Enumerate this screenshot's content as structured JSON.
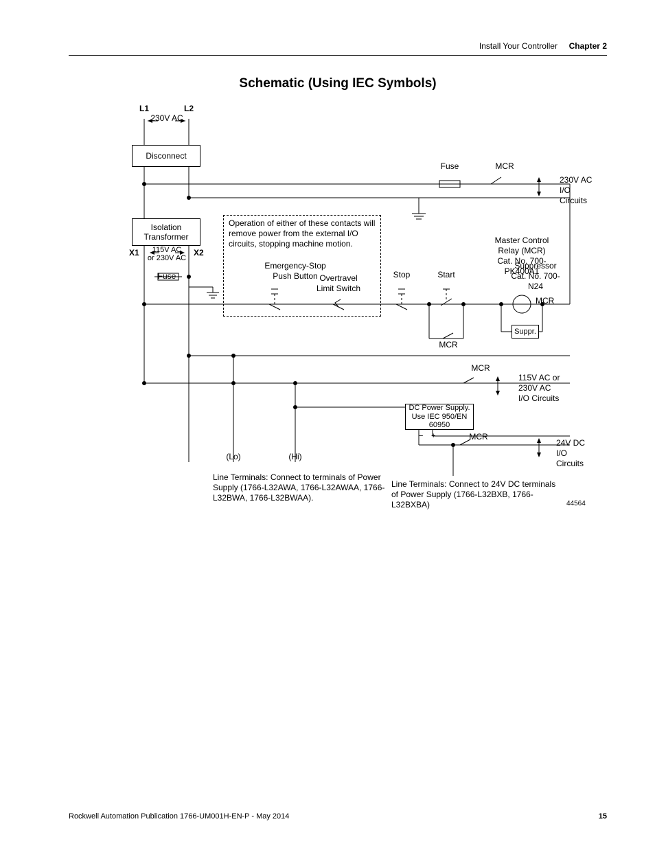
{
  "header": {
    "section_title": "Install Your Controller",
    "chapter_label": "Chapter 2"
  },
  "title": "Schematic (Using IEC Symbols)",
  "labels": {
    "L1": "L1",
    "L2": "L2",
    "v230": "230V AC",
    "disconnect": "Disconnect",
    "fuse_top": "Fuse",
    "mcr_top": "MCR",
    "io_230": "230V AC\nI/O\nCircuits",
    "iso_xfmr": "Isolation\nTransformer",
    "X1": "X1",
    "X2": "X2",
    "v115_or_230": "115V AC\nor 230V AC",
    "fuse_left": "Fuse",
    "note": "Operation of either of these contacts will remove power from the external I/O circuits, stopping machine motion.",
    "estop": "Emergency-Stop\nPush Button",
    "overtravel": "Overtravel\nLimit Switch",
    "stop": "Stop",
    "start": "Start",
    "mcr_info": "Master Control Relay (MCR)\nCat. No. 700-PK400A1",
    "supp_info": "Suppressor\nCat. No. 700-N24",
    "mcr_coil": "MCR",
    "suppr": "Suppr.",
    "mcr_contact": "MCR",
    "mcr_row3": "MCR",
    "io_115_230": "115V AC or\n230V AC\nI/O Circuits",
    "dc_supply": "DC Power Supply.\nUse IEC 950/EN 60950",
    "mcr_row4": "MCR",
    "io_24": "24V DC\nI/O\nCircuits",
    "lo": "(Lo)",
    "hi": "(Hi)",
    "minus": "−",
    "plus": "+",
    "line_terms_ac": "Line Terminals: Connect to terminals of Power Supply (1766-L32AWA, 1766-L32AWAA, 1766-L32BWA, 1766-L32BWAA).",
    "line_terms_dc": "Line Terminals: Connect to 24V DC terminals of Power Supply (1766-L32BXB, 1766-L32BXBA)",
    "figref": "44564"
  },
  "footer": {
    "publication": "Rockwell Automation Publication 1766-UM001H-EN-P - May 2014",
    "page": "15"
  }
}
